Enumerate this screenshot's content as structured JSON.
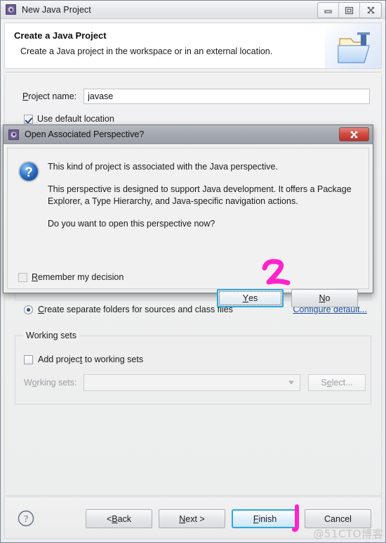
{
  "window": {
    "title": "New Java Project",
    "icon": "eclipse-gear-icon",
    "controls": {
      "minimize": "minimize-icon",
      "maximize": "maximize-restore-icon",
      "close": "close-icon"
    }
  },
  "header": {
    "title": "Create a Java Project",
    "description": "Create a Java project in the workspace or in an external location.",
    "banner_icon": "java-folder-icon"
  },
  "form": {
    "project_name_label": "Project name:",
    "project_name_mnemonic": "P",
    "project_name_value": "javase",
    "project_name_placeholder": "",
    "use_default_location_label": "Use default location",
    "use_default_location_checked": true,
    "separate_folders_label": "Create separate folders for sources and class files",
    "separate_folders_mnemonic": "C",
    "separate_folders_selected": true,
    "configure_default_link": "Configure default...",
    "working_sets": {
      "legend": "Working sets",
      "add_project_label": "Add project to working sets",
      "add_project_mnemonic": "t",
      "add_project_checked": false,
      "combo_label": "Working sets:",
      "combo_mnemonic": "o",
      "combo_value": "",
      "select_button": "Select...",
      "disabled": true
    }
  },
  "footer": {
    "help_icon": "help-question-icon",
    "buttons": [
      {
        "label": "< Back",
        "mnemonic": "B",
        "name": "back-button",
        "default": false
      },
      {
        "label": "Next >",
        "mnemonic": "N",
        "name": "next-button",
        "default": false
      },
      {
        "label": "Finish",
        "mnemonic": "F",
        "name": "finish-button",
        "default": true
      },
      {
        "label": "Cancel",
        "mnemonic": "",
        "name": "cancel-button",
        "default": false
      }
    ]
  },
  "dialog": {
    "title": "Open Associated Perspective?",
    "icon": "eclipse-gear-icon",
    "close_label": "x",
    "question_icon": "question-mark-icon",
    "messages": [
      "This kind of project is associated with the Java perspective.",
      "This perspective is designed to support Java development. It offers a Package Explorer, a Type Hierarchy, and Java-specific navigation actions.",
      "Do you want to open this perspective now?"
    ],
    "remember_label": "Remember my decision",
    "remember_mnemonic": "R",
    "remember_checked": false,
    "buttons": [
      {
        "label": "Yes",
        "mnemonic": "Y",
        "name": "yes-button",
        "focused": true
      },
      {
        "label": "No",
        "mnemonic": "N",
        "name": "no-button",
        "focused": false
      }
    ]
  },
  "annotations": {
    "color": "#ff22cc",
    "marks": [
      {
        "label": "1",
        "target": "finish-button"
      },
      {
        "label": "2",
        "target": "yes-button"
      }
    ]
  },
  "watermark": "@51CTO博客"
}
